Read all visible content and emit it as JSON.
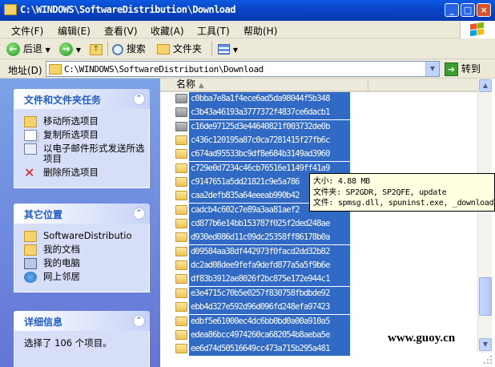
{
  "window": {
    "title": "C:\\WINDOWS\\SoftwareDistribution\\Download",
    "min": "_",
    "max": "□",
    "close": "×"
  },
  "menu": [
    "文件(F)",
    "编辑(E)",
    "查看(V)",
    "收藏(A)",
    "工具(T)",
    "帮助(H)"
  ],
  "toolbar": {
    "back": "后退",
    "search": "搜索",
    "folders": "文件夹"
  },
  "address": {
    "label": "地址(D)",
    "path": "C:\\WINDOWS\\SoftwareDistribution\\Download",
    "go": "转到"
  },
  "tasks": {
    "title": "文件和文件夹任务",
    "items": [
      "移动所选项目",
      "复制所选项目",
      "以电子邮件形式发送所选项目",
      "删除所选项目"
    ]
  },
  "places": {
    "title": "其它位置",
    "items": [
      "SoftwareDistributio",
      "我的文档",
      "我的电脑",
      "网上邻居"
    ]
  },
  "details": {
    "title": "详细信息",
    "text": "选择了 106 个项目。"
  },
  "list": {
    "column_name": "名称",
    "rows": [
      {
        "name": "c0bba7e8a1f4ece6ad5da98044f5b348",
        "icon": "gray-folder"
      },
      {
        "name": "c3b43a46193a3777372f4837ce6dacb1",
        "icon": "gray-folder"
      },
      {
        "name": "c16de97125d3e44640821f003732de0b",
        "icon": "gray-folder"
      },
      {
        "name": "c436c120195a87c0ca7281415f27fb6c",
        "icon": "folder"
      },
      {
        "name": "c674ad95533bc9df8e684b3149ad3960",
        "icon": "folder"
      },
      {
        "name": "c729e0d7234c46cb76516e1149ff41a9",
        "icon": "folder"
      },
      {
        "name": "c9147651a5dd21821c9e5a786",
        "icon": "folder"
      },
      {
        "name": "caa2defb835a64eeeab990b42",
        "icon": "folder"
      },
      {
        "name": "cadcb4c602c7e89a3aa81aef2",
        "icon": "folder"
      },
      {
        "name": "cd877b6e14bb153787f025f2ded248ae",
        "icon": "folder"
      },
      {
        "name": "d930ed086d11c09dc25358ff86178b0a",
        "icon": "folder"
      },
      {
        "name": "d09584aa38df442973f0facd2dd32b82",
        "icon": "folder"
      },
      {
        "name": "dc2ad08dee9fefa9defd877a5a5f9b6e",
        "icon": "folder"
      },
      {
        "name": "df83b3912ae8026f2bc875e172e944c1",
        "icon": "folder"
      },
      {
        "name": "e3e4715c70b5e0257f830758fbdbde92",
        "icon": "folder"
      },
      {
        "name": "ebb4d327e592d96d096fd248efa97423",
        "icon": "folder"
      },
      {
        "name": "edbf5e61000ec4dc6bb0bd0a00a910a5",
        "icon": "folder"
      },
      {
        "name": "edea86bcc4974260ca682054b8aeba5e",
        "icon": "folder"
      },
      {
        "name": "ee6d74d50516649cc473a715b295a481",
        "icon": "folder"
      }
    ]
  },
  "tooltip": {
    "size": "大小: 4.88 MB",
    "folders": "文件夹: SP2GDR, SP2QFE, update",
    "files": "文件: spmsg.dll, spuninst.exe, _download"
  },
  "watermark": "www.guoy.cn",
  "colors": {
    "titlebar": "#0a44c8",
    "selection": "#316ac5",
    "leftpane": "#6f8fdf",
    "tooltip": "#ffffe1"
  }
}
